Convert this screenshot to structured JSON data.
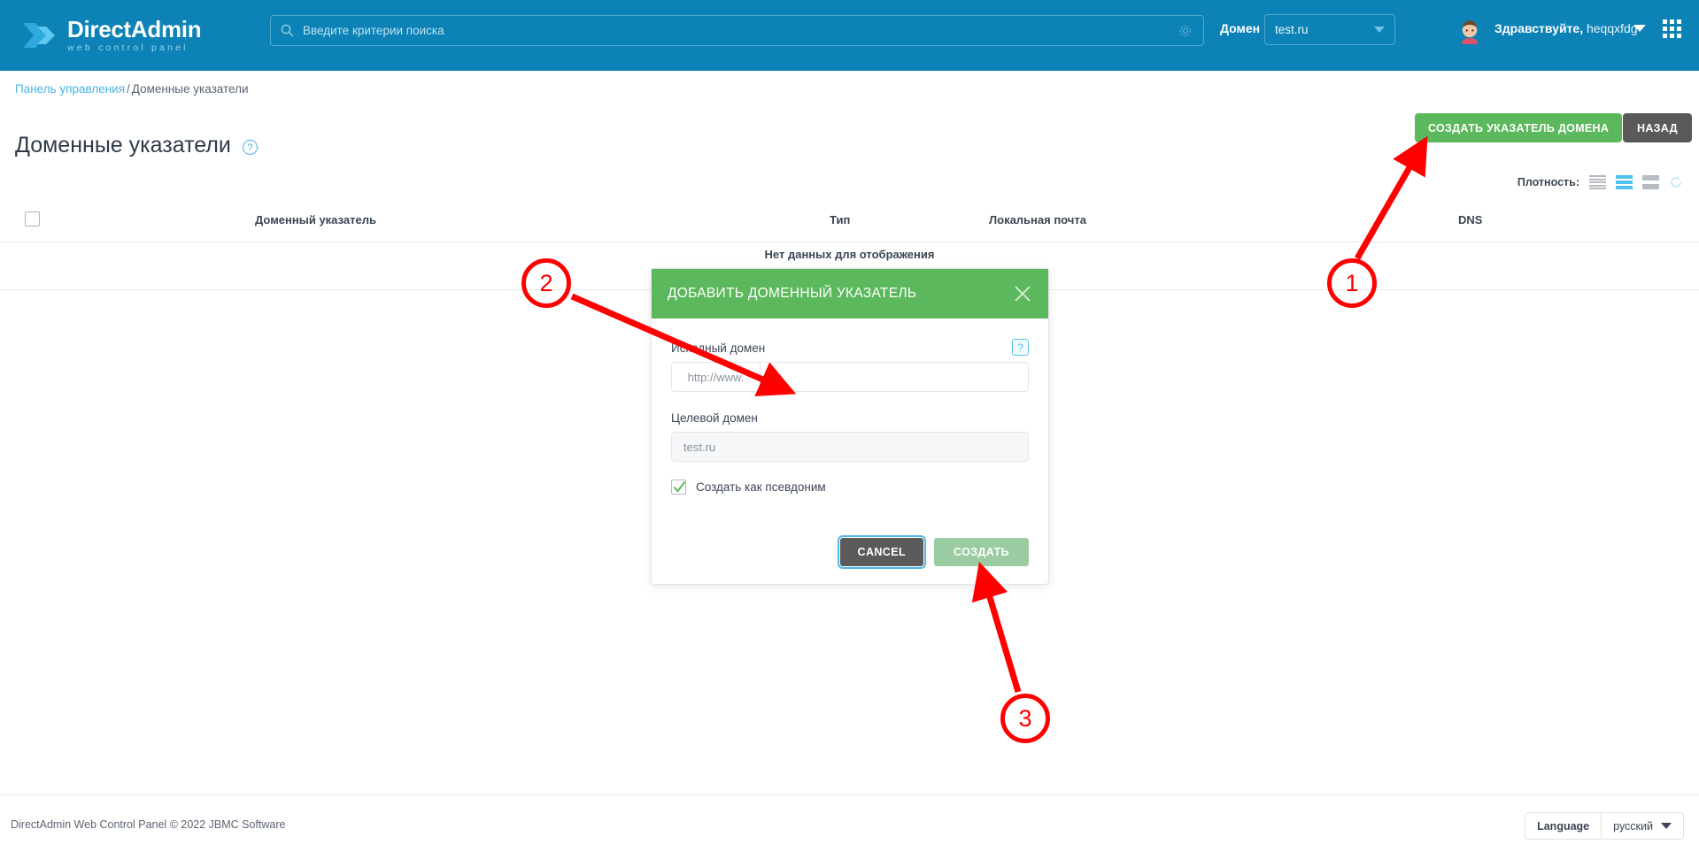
{
  "header": {
    "logo_title_1": "Direct",
    "logo_title_2": "Admin",
    "logo_subtitle": "web control panel",
    "search_placeholder": "Введите критерии поиска",
    "search_value": "",
    "domain_label": "Домен",
    "domain_value": "test.ru",
    "greeting": "Здравствуйте,",
    "username": "heqqxfdg"
  },
  "breadcrumb": {
    "root": "Панель управления",
    "separator": "/",
    "current": "Доменные указатели"
  },
  "page": {
    "title": "Доменные указатели",
    "help_glyph": "?",
    "create_button": "СОЗДАТЬ УКАЗАТЕЛЬ ДОМЕНА",
    "back_button": "НАЗАД"
  },
  "density": {
    "label": "Плотность:",
    "options": [
      "compact",
      "normal",
      "comfortable"
    ],
    "selected": "normal"
  },
  "table": {
    "columns": [
      "Доменный указатель",
      "Тип",
      "Локальная почта",
      "DNS"
    ],
    "rows": [],
    "empty_message": "Нет данных для отображения"
  },
  "modal": {
    "title": "ДОБАВИТЬ ДОМЕННЫЙ УКАЗАТЕЛЬ",
    "close_glyph": "×",
    "source_label": "Исходный домен",
    "source_help_glyph": "?",
    "source_prefix": "http://www.",
    "source_value": "",
    "target_label": "Целевой домен",
    "target_value": "test.ru",
    "checkbox_label": "Создать как псевдоним",
    "checkbox_checked": true,
    "cancel_button": "CANCEL",
    "submit_button": "СОЗДАТЬ"
  },
  "footer": {
    "copyright": "DirectAdmin Web Control Panel © 2022 JBMC Software",
    "language_label": "Language",
    "language_value": "русский"
  },
  "annotations": {
    "markers": [
      "1",
      "2",
      "3"
    ]
  },
  "colors": {
    "brand_blue": "#0C82B6",
    "accent_green": "#5CB85C",
    "link_blue": "#49B6E4",
    "dark_button": "#5A5A5A",
    "annotation_red": "#FF0000"
  }
}
